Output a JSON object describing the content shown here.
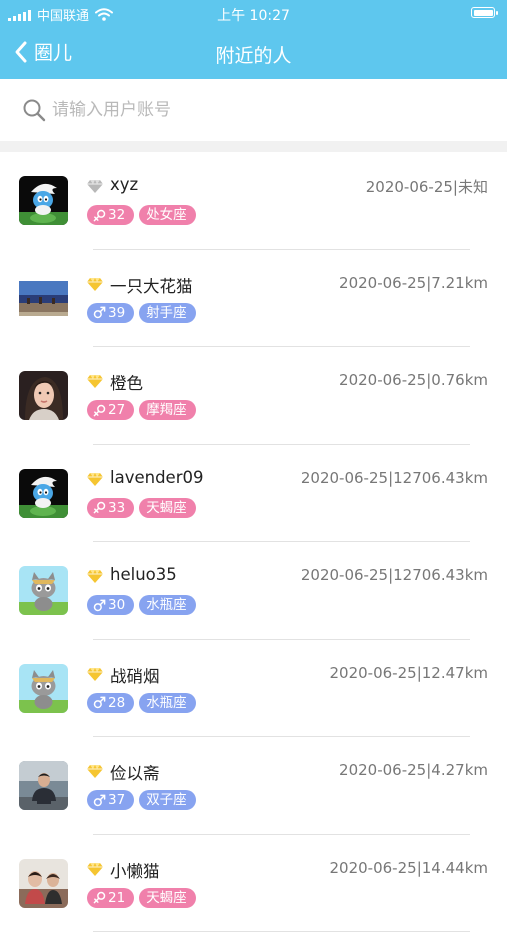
{
  "status_bar": {
    "carrier": "中国联通",
    "time": "上午 10:27"
  },
  "nav": {
    "back_label": "圈儿",
    "title": "附近的人"
  },
  "search": {
    "placeholder": "请输入用户账号"
  },
  "colors": {
    "header": "#5ec7ee",
    "female_tag": "#f080ab",
    "male_tag": "#87a3f0",
    "gem_gold": "#f5c531",
    "gem_silver": "#b8b8b8"
  },
  "users": [
    {
      "name": "xyz",
      "time": "2020-06-25",
      "distance": "未知",
      "gender": "female",
      "age": "32",
      "zodiac": "处女座",
      "gem": "silver",
      "avatar": "smurf"
    },
    {
      "name": "一只大花猫",
      "time": "2020-06-25",
      "distance": "7.21km",
      "gender": "male",
      "age": "39",
      "zodiac": "射手座",
      "gem": "gold",
      "avatar": "landscape"
    },
    {
      "name": "橙色",
      "time": "2020-06-25",
      "distance": "0.76km",
      "gender": "female",
      "age": "27",
      "zodiac": "摩羯座",
      "gem": "gold",
      "avatar": "portrait-female"
    },
    {
      "name": "lavender09",
      "time": "2020-06-25",
      "distance": "12706.43km",
      "gender": "female",
      "age": "33",
      "zodiac": "天蝎座",
      "gem": "gold",
      "avatar": "smurf"
    },
    {
      "name": "heluo35",
      "time": "2020-06-25",
      "distance": "12706.43km",
      "gender": "male",
      "age": "30",
      "zodiac": "水瓶座",
      "gem": "gold",
      "avatar": "cartoon-cat"
    },
    {
      "name": "战硝烟",
      "time": "2020-06-25",
      "distance": "12.47km",
      "gender": "male",
      "age": "28",
      "zodiac": "水瓶座",
      "gem": "gold",
      "avatar": "cartoon-cat"
    },
    {
      "name": "俭以斋",
      "time": "2020-06-25",
      "distance": "4.27km",
      "gender": "male",
      "age": "37",
      "zodiac": "双子座",
      "gem": "gold",
      "avatar": "portrait-male"
    },
    {
      "name": "小懒猫",
      "time": "2020-06-25",
      "distance": "14.44km",
      "gender": "female",
      "age": "21",
      "zodiac": "天蝎座",
      "gem": "gold",
      "avatar": "portrait-group"
    }
  ]
}
